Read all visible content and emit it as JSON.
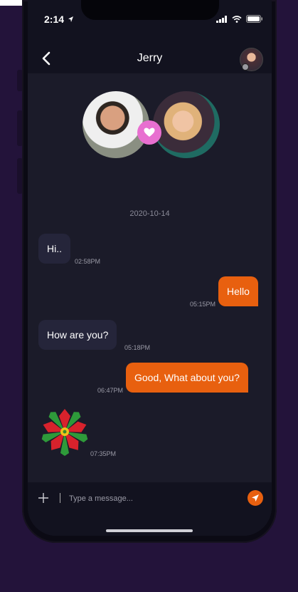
{
  "status": {
    "time": "2:14"
  },
  "header": {
    "title": "Jerry"
  },
  "chat": {
    "date": "2020-10-14",
    "messages": [
      {
        "direction": "in",
        "text": "Hi..",
        "time": "02:58PM"
      },
      {
        "direction": "out",
        "text": "Hello",
        "time": "05:15PM"
      },
      {
        "direction": "in",
        "text": "How are you?",
        "time": "05:18PM"
      },
      {
        "direction": "out",
        "text": "Good, What about you?",
        "time": "06:47PM"
      },
      {
        "direction": "in",
        "sticker": "poinsettia-flower",
        "time": "07:35PM"
      }
    ]
  },
  "composer": {
    "placeholder": "Type a message..."
  },
  "colors": {
    "accent": "#e8600f",
    "heart": "#e86fd0",
    "background": "#1b1b29",
    "bubble_in": "#25253a"
  },
  "icons": [
    "back-chevron-icon",
    "heart-icon",
    "plus-icon",
    "send-icon",
    "location-arrow-icon",
    "wifi-icon",
    "battery-icon",
    "signal-icon"
  ]
}
